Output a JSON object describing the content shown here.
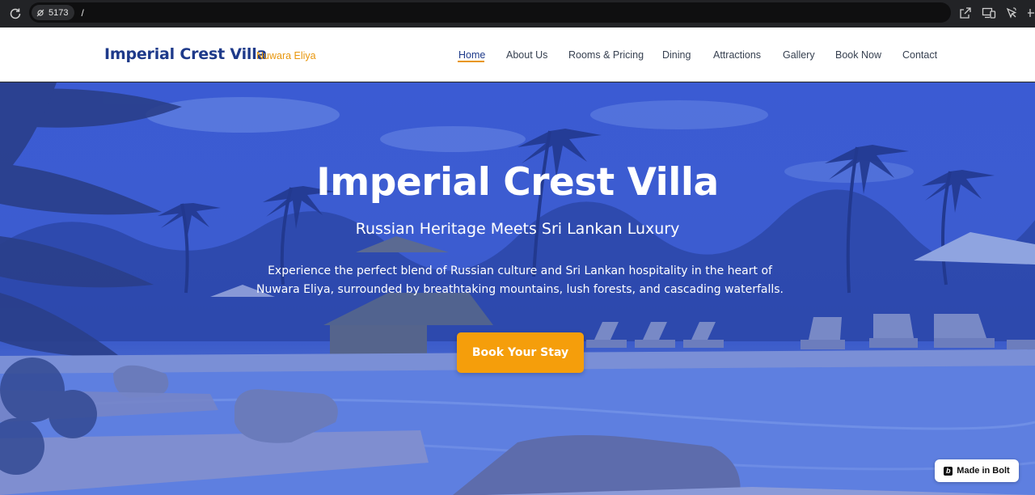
{
  "browser": {
    "url_chip": "5173",
    "url_path": "/"
  },
  "header": {
    "brand_title": "Imperial Crest Villa",
    "brand_subtitle": "Nuwara Eliya",
    "nav": [
      "Home",
      "About Us",
      "Rooms & Pricing",
      "Dining",
      "Attractions",
      "Gallery",
      "Book Now",
      "Contact"
    ],
    "active_nav": "Home"
  },
  "hero": {
    "title": "Imperial Crest Villa",
    "subtitle": "Russian Heritage Meets Sri Lankan Luxury",
    "description": "Experience the perfect blend of Russian culture and Sri Lankan hospitality in the heart of Nuwara Eliya, surrounded by breathtaking mountains, lush forests, and cascading waterfalls.",
    "cta_label": "Book Your Stay"
  },
  "badge": {
    "label": "Made in Bolt"
  },
  "colors": {
    "brand": "#1e3a8a",
    "accent": "#f59e0b",
    "hero_overlay": "#3b5bd3"
  }
}
